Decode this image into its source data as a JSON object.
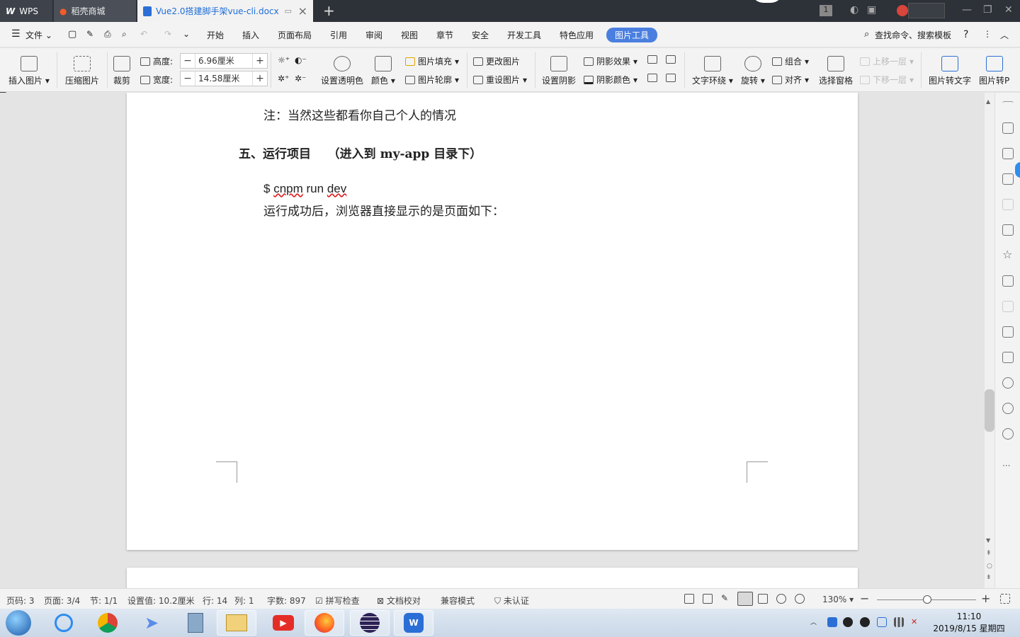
{
  "tabs": {
    "wps": "WPS",
    "store": "稻壳商城",
    "doc": "Vue2.0搭建脚手架vue-cli.docx"
  },
  "menu": {
    "file": "文件",
    "items": [
      "开始",
      "插入",
      "页面布局",
      "引用",
      "审阅",
      "视图",
      "章节",
      "安全",
      "开发工具",
      "特色应用",
      "图片工具"
    ],
    "search": "查找命令、搜索模板"
  },
  "toolbar": {
    "insert_pic": "插入图片",
    "compress": "压缩图片",
    "crop": "裁剪",
    "height_label": "高度:",
    "height_value": "6.96厘米",
    "width_label": "宽度:",
    "width_value": "14.58厘米",
    "transparent": "设置透明色",
    "color": "颜色",
    "fill": "图片填充",
    "outline": "图片轮廓",
    "change": "更改图片",
    "reset": "重设图片",
    "shadow": "设置阴影",
    "shadow_effect": "阴影效果",
    "shadow_color": "阴影颜色",
    "wrap": "文字环绕",
    "rotate": "旋转",
    "group": "组合",
    "align": "对齐",
    "select_pane": "选择窗格",
    "bring_up": "上移一层",
    "send_down": "下移一层",
    "pic_to_text": "图片转文字",
    "pic_to_pdf": "图片转P"
  },
  "document": {
    "note": "注：当然这些都看你自己个人的情况",
    "heading": "五、运行项目    （进入到 my-app 目录下）",
    "command_prefix": "$ ",
    "command_words": [
      "cnpm",
      "run",
      "dev"
    ],
    "result": "运行成功后，浏览器直接显示的是页面如下："
  },
  "status": {
    "page_code": "页码: 3",
    "page": "页面: 3/4",
    "section": "节: 1/1",
    "setting": "设置值: 10.2厘米",
    "row": "行: 14",
    "col": "列: 1",
    "words": "字数: 897",
    "spell": "拼写检查",
    "proof": "文档校对",
    "compat": "兼容模式",
    "cert": "未认证",
    "zoom": "130%"
  },
  "clock": {
    "time": "11:10",
    "date": "2019/8/15 星期四"
  },
  "colors": {
    "accent": "#4a7fe0",
    "titlebar": "#2d3138"
  }
}
